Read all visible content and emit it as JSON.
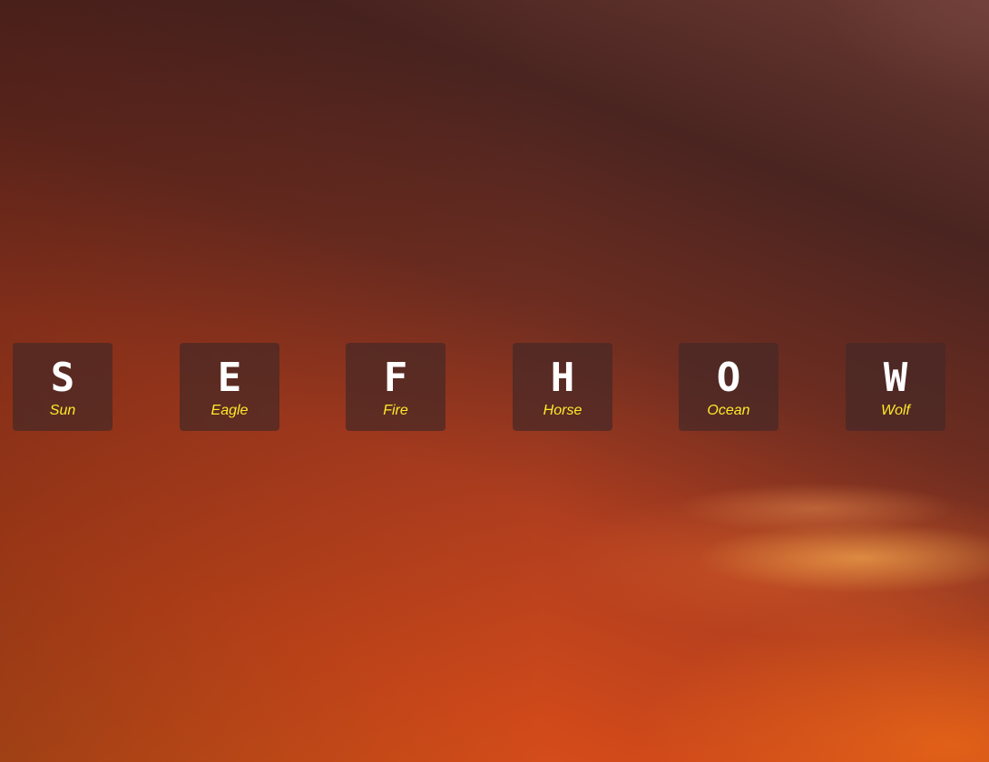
{
  "colors": {
    "tile_background": "#4a2a27",
    "letter": "#ffffff",
    "word": "#ffea2a"
  },
  "tiles": [
    {
      "letter": "S",
      "word": "Sun"
    },
    {
      "letter": "E",
      "word": "Eagle"
    },
    {
      "letter": "F",
      "word": "Fire"
    },
    {
      "letter": "H",
      "word": "Horse"
    },
    {
      "letter": "O",
      "word": "Ocean"
    },
    {
      "letter": "W",
      "word": "Wolf"
    }
  ]
}
